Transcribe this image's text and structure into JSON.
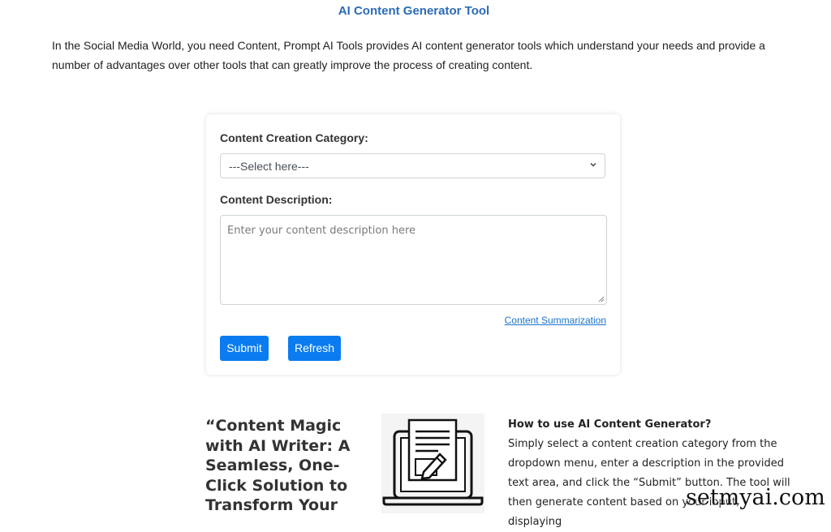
{
  "page": {
    "title": "AI Content Generator Tool",
    "intro": "In the Social Media World, you need Content, Prompt AI Tools provides AI content generator tools which understand your needs and provide a number of advantages over other tools that can greatly improve the process of creating content."
  },
  "form": {
    "category_label": "Content Creation Category:",
    "category_selected": "---Select here---",
    "description_label": "Content Description:",
    "description_placeholder": "Enter your content description here",
    "summarization_link": "Content Summarization",
    "submit_label": "Submit",
    "refresh_label": "Refresh"
  },
  "feature": {
    "quote": "“Content Magic with AI Writer: A Seamless, One-Click Solution to Transform Your",
    "howto_title": "How to use AI Content Generator?",
    "howto_body": "Simply select a content creation category from the dropdown menu, enter a description in the provided text area, and click the “Submit” button. The tool will then generate content based on your input, displaying"
  },
  "watermark": "setmyai.com",
  "icons": {
    "select_chevron": "chevron-down-icon",
    "illustration": "laptop-document-pen-icon"
  },
  "colors": {
    "title": "#2a6bb8",
    "button": "#0b7cf0",
    "link": "#1a73c9"
  }
}
